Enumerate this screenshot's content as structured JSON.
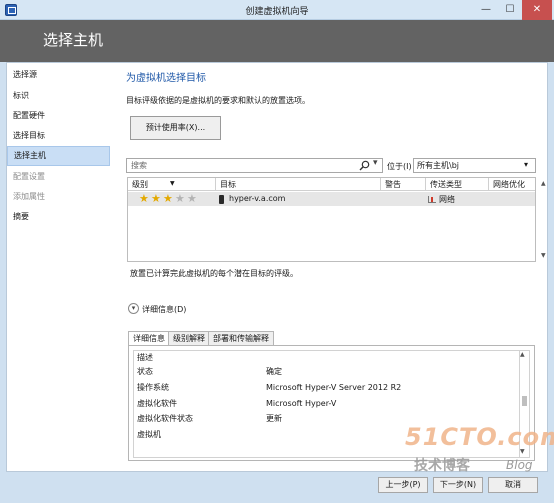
{
  "window": {
    "title": "创建虚拟机向导",
    "minimize_glyph": "—",
    "maximize_glyph": "☐",
    "close_glyph": "✕"
  },
  "header": {
    "title": "选择主机"
  },
  "nav": {
    "items": [
      {
        "label": "选择源",
        "state": "normal"
      },
      {
        "label": "标识",
        "state": "normal"
      },
      {
        "label": "配置硬件",
        "state": "normal"
      },
      {
        "label": "选择目标",
        "state": "normal"
      },
      {
        "label": "选择主机",
        "state": "active"
      },
      {
        "label": "配置设置",
        "state": "disabled"
      },
      {
        "label": "添加属性",
        "state": "disabled"
      },
      {
        "label": "摘要",
        "state": "normal"
      }
    ]
  },
  "main": {
    "title": "为虚拟机选择目标",
    "description": "目标评级依据的是虚拟机的要求和默认的放置选项。",
    "estimate_button": "预计使用率(X)...",
    "search_placeholder": "搜索",
    "in_label": "位于(I)",
    "host_group": "所有主机\\bj",
    "grid": {
      "columns": [
        "级别",
        "目标",
        "警告",
        "传送类型",
        "网络优化"
      ],
      "rows": [
        {
          "rating_stars": 3,
          "rating_max": 5,
          "target": "hyper-v.a.com",
          "warning": "",
          "transfer_type": "网络",
          "network_optimization": ""
        }
      ]
    },
    "rating_note": "放置已计算完此虚拟机的每个潜在目标的评级。",
    "details_toggle": "详细信息(D)",
    "tabs": [
      "详细信息",
      "级别解释",
      "部署和传输解释"
    ],
    "details": [
      {
        "label": "描述",
        "value": ""
      },
      {
        "label": "状态",
        "value": "确定"
      },
      {
        "label": "操作系统",
        "value": "Microsoft Hyper-V Server 2012 R2"
      },
      {
        "label": "虚拟化软件",
        "value": "Microsoft Hyper-V"
      },
      {
        "label": "虚拟化软件状态",
        "value": "更新"
      },
      {
        "label": "虚拟机",
        "value": ""
      }
    ]
  },
  "footer": {
    "prev": "上一步(P)",
    "next": "下一步(N)",
    "cancel": "取消"
  },
  "watermark": {
    "main": "51CTO.com",
    "sub": "技术博客",
    "blog": "Blog"
  },
  "colors": {
    "header_bg": "#636363",
    "accent_title": "#1f58a8",
    "close_red": "#c7504f",
    "star_on": "#e3a900"
  }
}
